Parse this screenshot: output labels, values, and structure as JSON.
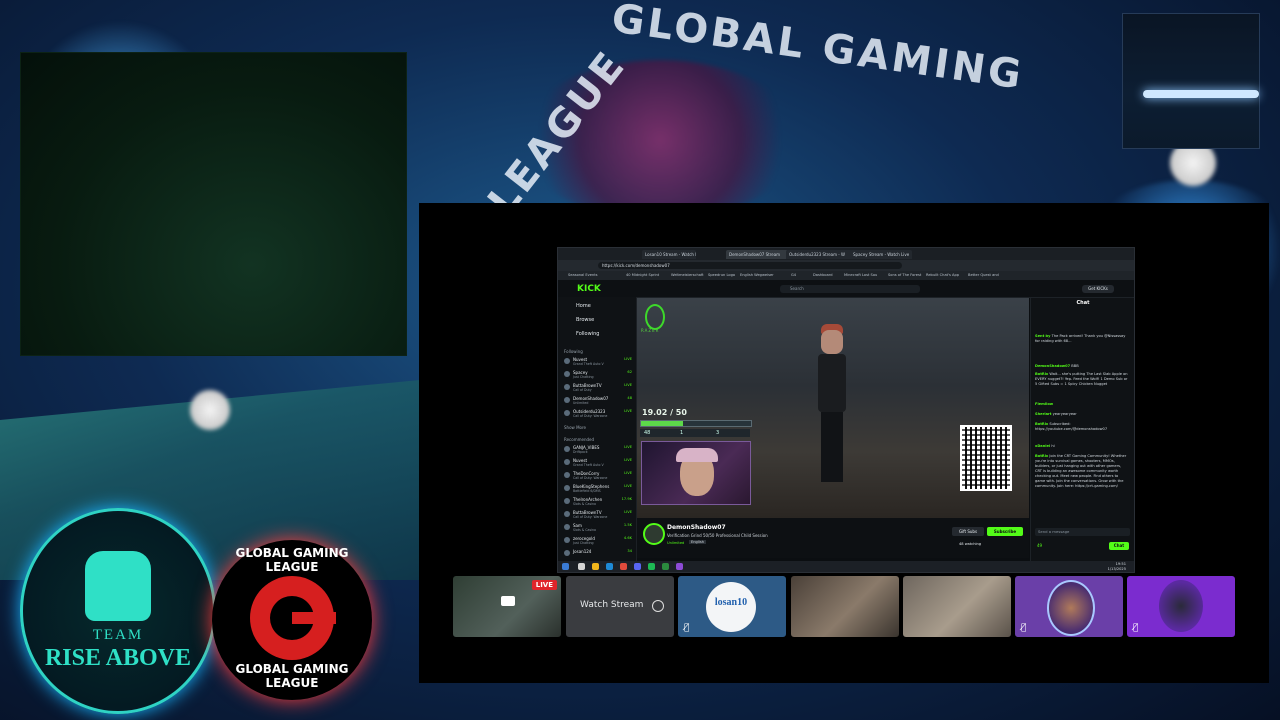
{
  "background": {
    "title_line1": "GLOBAL GAMING",
    "title_line2": "LEAGUE",
    "colors": {
      "sky": "#0e2a52",
      "glow": "#19b3ff",
      "accent_red": "#d61f1f"
    }
  },
  "logos": {
    "team": {
      "line1": "TEAM",
      "line2": "RISE ABOVE"
    },
    "ggl": {
      "ring_top": "GLOBAL GAMING LEAGUE",
      "ring_bottom": "GLOBAL GAMING LEAGUE"
    }
  },
  "browser": {
    "tabs": [
      "Losan10 Stream - Watch Live on",
      "DemonShadow07 Stream",
      "Outsiderdu2323 Stream - W",
      "Spacey Stream - Watch Live"
    ],
    "url": "https://kick.com/demonshadow07",
    "bookmarks": [
      "Seasonal Events",
      "40 Midnight Sprint",
      "Weltmeisterschaft",
      "Speedrun Logo",
      "English Wegweiser",
      "G4",
      "Dashboard",
      "Minecraft Lost Sou",
      "Sons of The Forest",
      "Rebuilt Chat's App",
      "Better Quest and"
    ],
    "kick": {
      "logo": "KICK",
      "search_placeholder": "Search",
      "get_kicks": "Get KICKs",
      "nav": [
        "Home",
        "Browse",
        "Following"
      ],
      "following_header": "Following",
      "following": [
        {
          "name": "Nuvest",
          "game": "Grand Theft Auto V",
          "viewers": "LIVE"
        },
        {
          "name": "Spacey",
          "game": "Just Chatting",
          "viewers": "62"
        },
        {
          "name": "ButtaBrownTV",
          "game": "Call of Duty",
          "viewers": "LIVE"
        },
        {
          "name": "DemonShadow07",
          "game": "Unlimited",
          "viewers": "48"
        },
        {
          "name": "Outsiderdu2323",
          "game": "Call of Duty: Warzone",
          "viewers": "LIVE"
        }
      ],
      "show_more": "Show More",
      "recommended_header": "Recommended",
      "recommended": [
        {
          "name": "GANJA_VIBES",
          "game": "Driftpack",
          "viewers": "LIVE"
        },
        {
          "name": "Nuvest",
          "game": "Grand Theft Auto V",
          "viewers": "LIVE"
        },
        {
          "name": "TheDonCorry",
          "game": "Call of Duty: Warzone",
          "viewers": "LIVE"
        },
        {
          "name": "BlueKingStephens",
          "game": "Battlefield 6/DMS",
          "viewers": "LIVE"
        },
        {
          "name": "TheIronArchen",
          "game": "Slots & Casino",
          "viewers": "17.9K"
        },
        {
          "name": "ButtaBrownTV",
          "game": "Call of Duty: Warzone",
          "viewers": "LIVE"
        },
        {
          "name": "Sam",
          "game": "Slots & Casino",
          "viewers": "1.5K"
        },
        {
          "name": "zerocegold",
          "game": "Just Chatting",
          "viewers": "4.6K"
        },
        {
          "name": "Josan124",
          "game": "",
          "viewers": "34"
        }
      ]
    },
    "stream": {
      "overlay_counter": "19.02 / 50",
      "counter_progress": 0.38,
      "stats": [
        "48",
        "1",
        "3"
      ],
      "razer_word": "RAZER",
      "streamer": "DemonShadow07",
      "title": "Verification Grind 50/50 Professional Child Session",
      "category": "Unlimited",
      "language": "English",
      "gift_subs": "Gift Subs",
      "subscribe": "Subscribe",
      "viewers": "48 watching"
    },
    "chat": {
      "title": "Chat",
      "messages": [
        {
          "user": "Sent by",
          "text": "The Pack arrived! Thank you @Nissassay for raiding with 68..."
        },
        {
          "user": "DemonShadow07",
          "text": "BBB"
        },
        {
          "user": "BotRix",
          "text": "Wait... she's putting The Last Slab Apple on EVERY nugget?! Yep. Feed the Wolf! 1 Demo Sub or 5 Gifted Subs = 1 Spicy Chicken Nugget"
        },
        {
          "user": "Flemilow",
          "text": ""
        },
        {
          "user": "Sheriart",
          "text": "yearyearyear"
        },
        {
          "user": "BotRix",
          "text": "Subscribed: https://youtube.com/@demonshadow07"
        },
        {
          "user": "xDaniel",
          "text": "hi"
        },
        {
          "user": "BotRix",
          "text": "Join the CRT Gaming Community! Whether you're into survival games, shooters, MMOs, builders, or just hanging out with other gamers, CRT is building an awesome community worth checking out. Meet new people. Find others to game with. Join the conversations. Grow with the community. Join here: https://crt-gaming.com/"
        }
      ],
      "input_placeholder": "Send a message",
      "send": "Chat",
      "points": "49"
    },
    "taskbar": {
      "time": "19:51",
      "date": "1/13/2025"
    }
  },
  "participants": [
    {
      "label": "",
      "badge": "LIVE",
      "bg": "#3a4a3a"
    },
    {
      "label": "Watch Stream",
      "bg": "#3a3c40"
    },
    {
      "label": "losan10",
      "bg": "#2d5a86",
      "muted": true
    },
    {
      "label": "",
      "bg": "#5a5048"
    },
    {
      "label": "",
      "bg": "#7a7068"
    },
    {
      "label": "",
      "bg": "#6a3fa8",
      "muted": true
    },
    {
      "label": "",
      "bg": "#7b2ccf",
      "muted": true
    }
  ]
}
